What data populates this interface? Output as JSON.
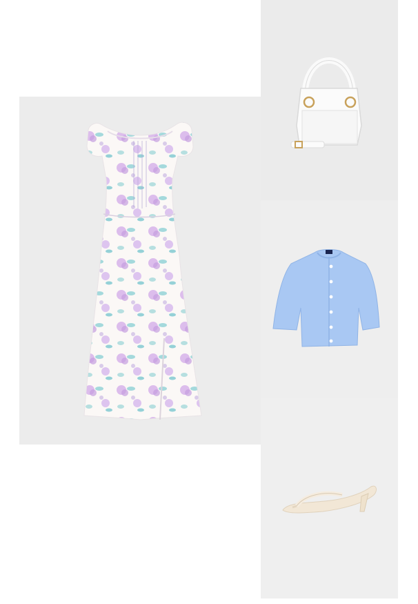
{
  "outfit": {
    "items": [
      {
        "name": "floral-midi-dress",
        "icon": "dress-icon",
        "colors": [
          "#fbf8f6",
          "#c9a6e0",
          "#7cc7cf"
        ]
      },
      {
        "name": "white-mini-handbag",
        "icon": "bag-icon",
        "colors": [
          "#fbfbfb",
          "#c8a15a"
        ]
      },
      {
        "name": "blue-cropped-cardigan",
        "icon": "cardigan-icon",
        "colors": [
          "#a9c8f3"
        ]
      },
      {
        "name": "cream-kitten-heel-thong-sandal",
        "icon": "sandal-icon",
        "colors": [
          "#f2e7d6"
        ]
      }
    ]
  },
  "colors": {
    "page_background": "#ffffff",
    "tile_background": "#ececec"
  }
}
